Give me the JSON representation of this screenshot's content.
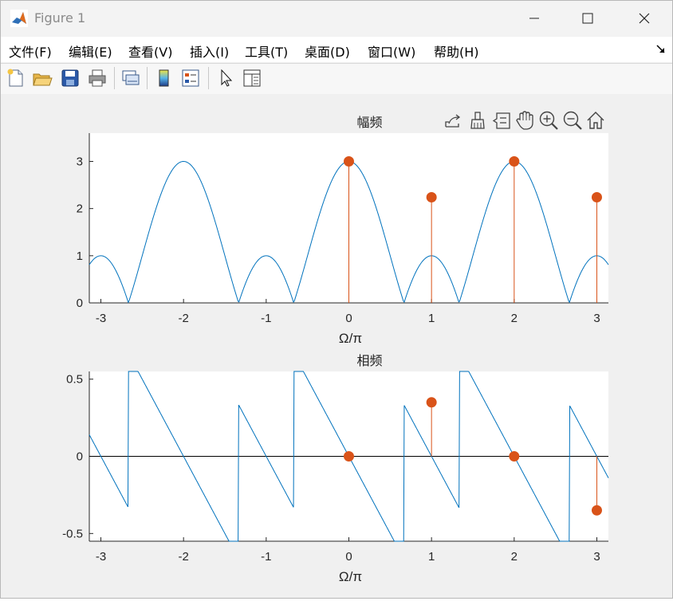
{
  "window": {
    "title": "Figure 1"
  },
  "menu": {
    "items": [
      "文件(F)",
      "编辑(E)",
      "查看(V)",
      "插入(I)",
      "工具(T)",
      "桌面(D)",
      "窗口(W)",
      "帮助(H)"
    ]
  },
  "toolbar": {
    "buttons": [
      "new-figure-icon",
      "open-file-icon",
      "save-icon",
      "print-icon",
      "link-plot-icon",
      "colorbar-icon",
      "legend-icon",
      "edit-plot-icon",
      "property-inspector-icon"
    ]
  },
  "axes_toolbar": {
    "buttons": [
      "export-icon",
      "brush-icon",
      "data-tips-icon",
      "pan-icon",
      "zoom-in-icon",
      "zoom-out-icon",
      "home-icon"
    ]
  },
  "colors": {
    "line": "#0072BD",
    "stem": "#D95319"
  },
  "chart_data": [
    {
      "type": "line",
      "title": "幅频",
      "xlabel": "Ω/π",
      "ylabel": "",
      "xlim": [
        -3.14,
        3.14
      ],
      "ylim": [
        0,
        3.6
      ],
      "xticks": [
        "-3",
        "-2",
        "-1",
        "0",
        "1",
        "2",
        "3"
      ],
      "yticks": [
        "0",
        "1",
        "2",
        "3"
      ],
      "series": [
        {
          "kind": "line",
          "expr": "|1 + e^{-jw} + e^{-j2w}|, w = pi*x"
        },
        {
          "kind": "stem",
          "x": [
            0,
            1,
            2,
            3
          ],
          "y": [
            3,
            2.24,
            3,
            2.24
          ]
        }
      ]
    },
    {
      "type": "line",
      "title": "相频",
      "xlabel": "Ω/π",
      "ylabel": "",
      "xlim": [
        -3.14,
        3.14
      ],
      "ylim": [
        -0.55,
        0.55
      ],
      "xticks": [
        "-3",
        "-2",
        "-1",
        "0",
        "1",
        "2",
        "3"
      ],
      "yticks": [
        "0.5",
        "0",
        "-0.5"
      ],
      "series": [
        {
          "kind": "line",
          "expr": "phase/pi with jumps near x = -1.05 and x = 1.05"
        },
        {
          "kind": "stem",
          "x": [
            0,
            1,
            2,
            3
          ],
          "y": [
            0,
            0.35,
            0,
            -0.35
          ]
        }
      ]
    }
  ]
}
